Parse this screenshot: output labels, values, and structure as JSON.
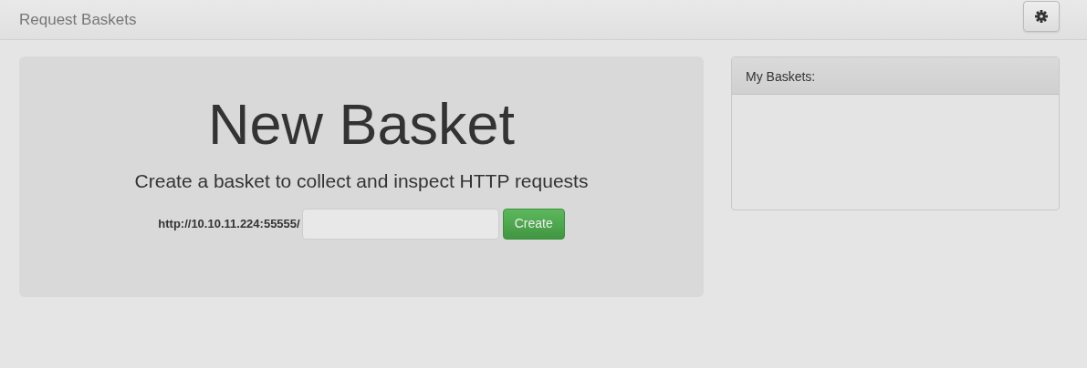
{
  "navbar": {
    "brand": "Request Baskets"
  },
  "jumbotron": {
    "title": "New Basket",
    "subtitle": "Create a basket to collect and inspect HTTP requests",
    "url_prefix": "http://10.10.11.224:55555/",
    "create_button": "Create"
  },
  "baskets_panel": {
    "title": "My Baskets:"
  }
}
